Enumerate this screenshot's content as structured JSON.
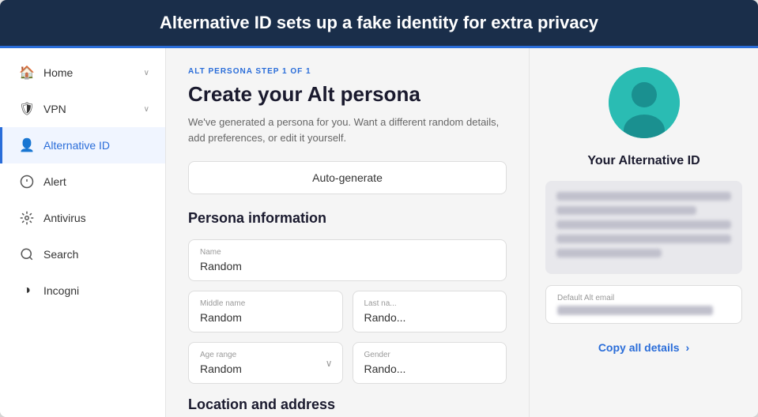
{
  "banner": {
    "text": "Alternative ID sets up a fake identity for extra privacy"
  },
  "sidebar": {
    "items": [
      {
        "id": "home",
        "label": "Home",
        "icon": "🏠",
        "hasChevron": true,
        "active": false
      },
      {
        "id": "vpn",
        "label": "VPN",
        "icon": "🛡",
        "hasChevron": true,
        "active": false
      },
      {
        "id": "alternative-id",
        "label": "Alternative ID",
        "icon": "👤",
        "hasChevron": false,
        "active": true
      },
      {
        "id": "alert",
        "label": "Alert",
        "icon": "🔔",
        "hasChevron": false,
        "active": false
      },
      {
        "id": "antivirus",
        "label": "Antivirus",
        "icon": "⚙",
        "hasChevron": false,
        "active": false
      },
      {
        "id": "search",
        "label": "Search",
        "icon": "🔍",
        "hasChevron": false,
        "active": false
      },
      {
        "id": "incogni",
        "label": "Incogni",
        "icon": "◑",
        "hasChevron": false,
        "active": false
      }
    ]
  },
  "main": {
    "step_label": "ALT PERSONA STEP 1 OF 1",
    "title": "Create your Alt persona",
    "description": "We've generated a persona for you. Want a different random details, add preferences, or edit it yourself.",
    "auto_generate_label": "Auto-generate",
    "persona_section_title": "Persona information",
    "fields": {
      "name_label": "Name",
      "name_value": "Random",
      "middle_name_label": "Middle name",
      "middle_name_value": "Random",
      "last_name_label": "Last na...",
      "last_name_value": "Rando...",
      "age_range_label": "Age range",
      "age_range_value": "Random",
      "gender_label": "Gender",
      "gender_value": "Rando..."
    },
    "location_section_title": "Location and address"
  },
  "right_panel": {
    "alt_id_title": "Your Alternative ID",
    "copy_label": "Copy all details",
    "default_alt_email_label": "Default Alt email"
  }
}
